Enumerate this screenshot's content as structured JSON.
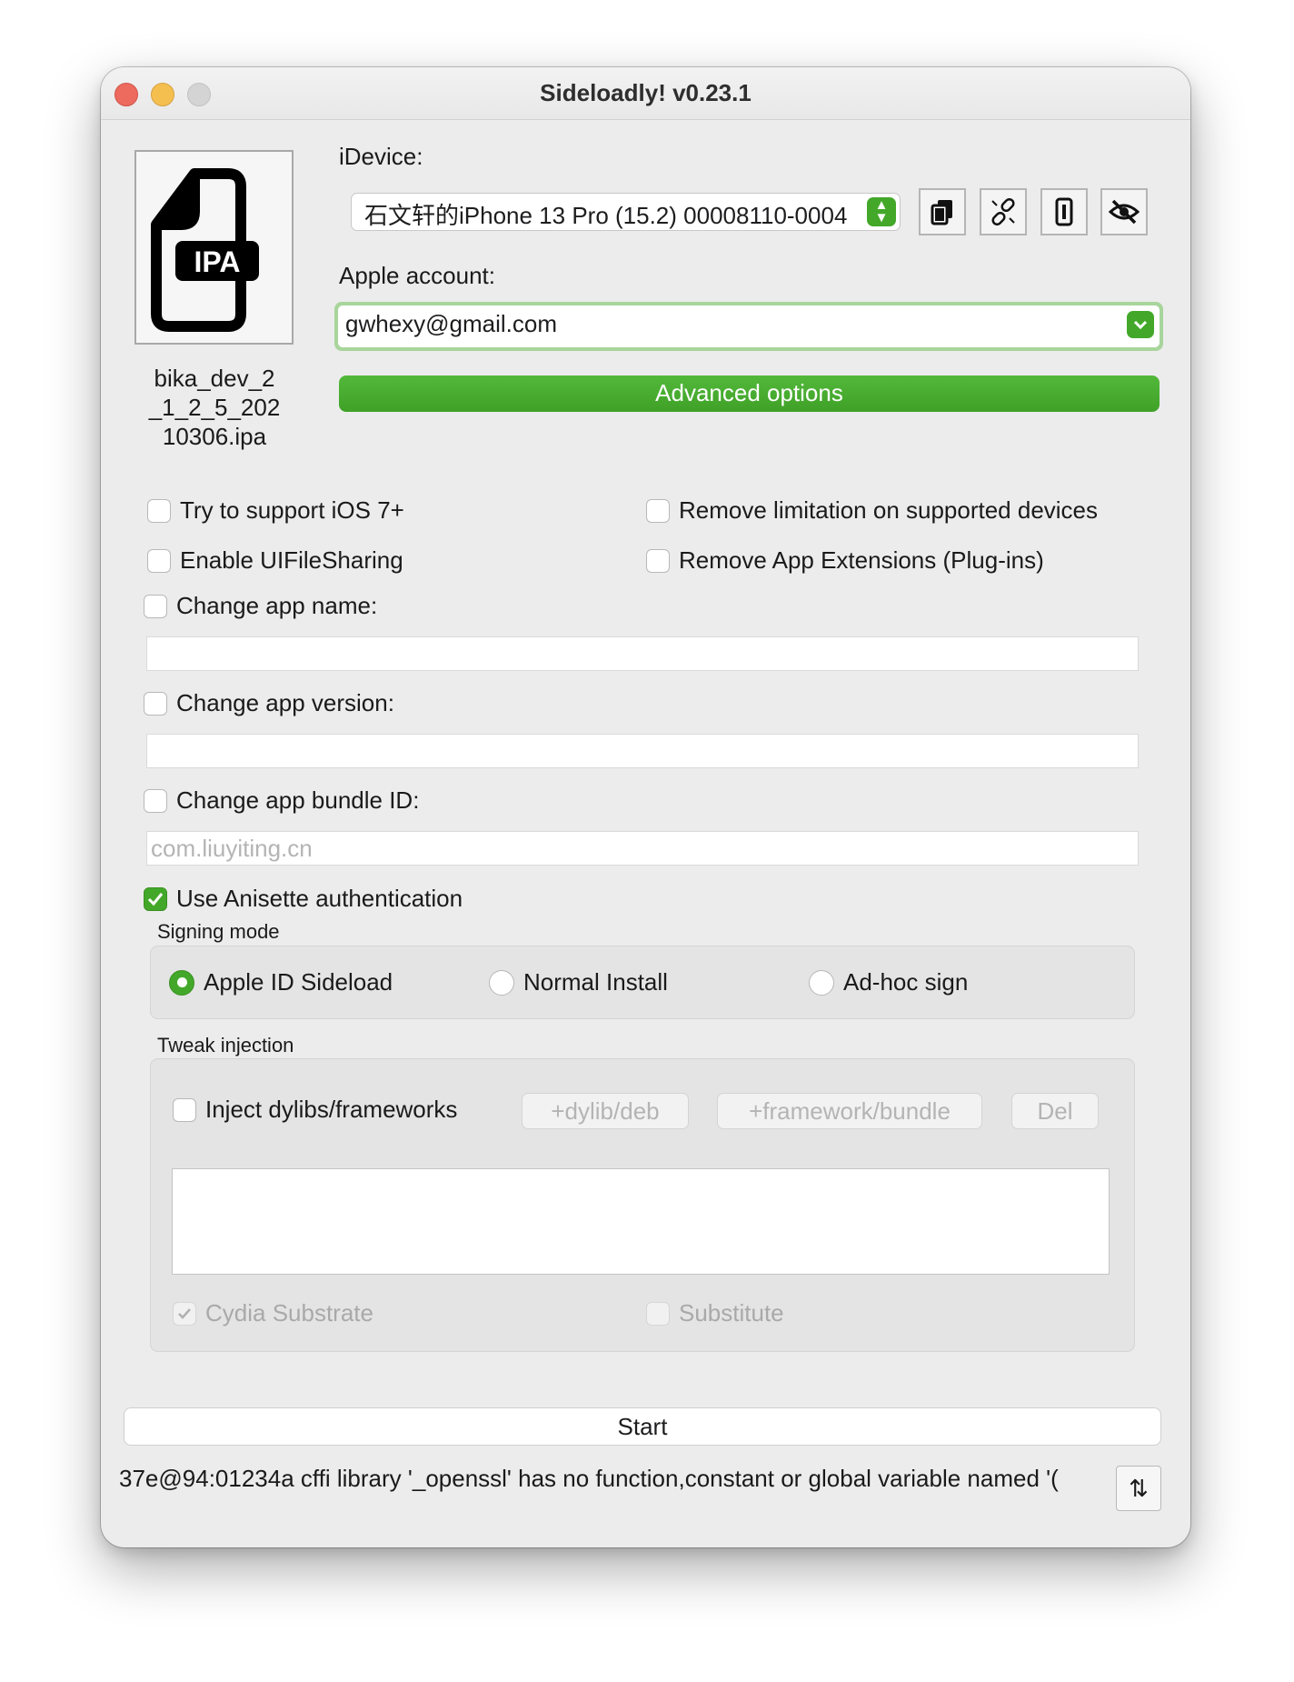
{
  "window": {
    "title": "Sideloadly! v0.23.1"
  },
  "ipa": {
    "badge": "IPA",
    "filename_lines": [
      "bika_dev_2",
      "_1_2_5_202",
      "10306.ipa"
    ]
  },
  "device": {
    "label": "iDevice:",
    "selected": "石文轩的iPhone 13 Pro (15.2) 00008110-0004",
    "tools": [
      "copy-icon",
      "unlink-icon",
      "phone-icon",
      "hide-icon"
    ]
  },
  "account": {
    "label": "Apple account:",
    "value": "gwhexy@gmail.com"
  },
  "advanced_button": "Advanced options",
  "options": {
    "ios7": "Try to support iOS 7+",
    "remove_limitation": "Remove limitation on supported devices",
    "file_sharing": "Enable UIFileSharing",
    "remove_extensions": "Remove App Extensions (Plug-ins)",
    "change_name": "Change app name:",
    "change_version": "Change app version:",
    "change_bundle": "Change app bundle ID:",
    "bundle_placeholder": "com.liuyiting.cn",
    "anisette": "Use Anisette authentication"
  },
  "signing": {
    "label": "Signing mode",
    "modes": [
      "Apple ID Sideload",
      "Normal Install",
      "Ad-hoc sign"
    ],
    "selected": "Apple ID Sideload"
  },
  "tweak": {
    "label": "Tweak injection",
    "inject": "Inject dylibs/frameworks",
    "add_dylib": "+dylib/deb",
    "add_framework": "+framework/bundle",
    "del": "Del",
    "cydia": "Cydia Substrate",
    "substitute": "Substitute"
  },
  "start_button": "Start",
  "log": {
    "text": "37e@94:01234a cffi library '_openssl' has no function,constant or global variable named '(",
    "toggle_icon": "⇅"
  },
  "colors": {
    "accent": "#43a82a"
  }
}
